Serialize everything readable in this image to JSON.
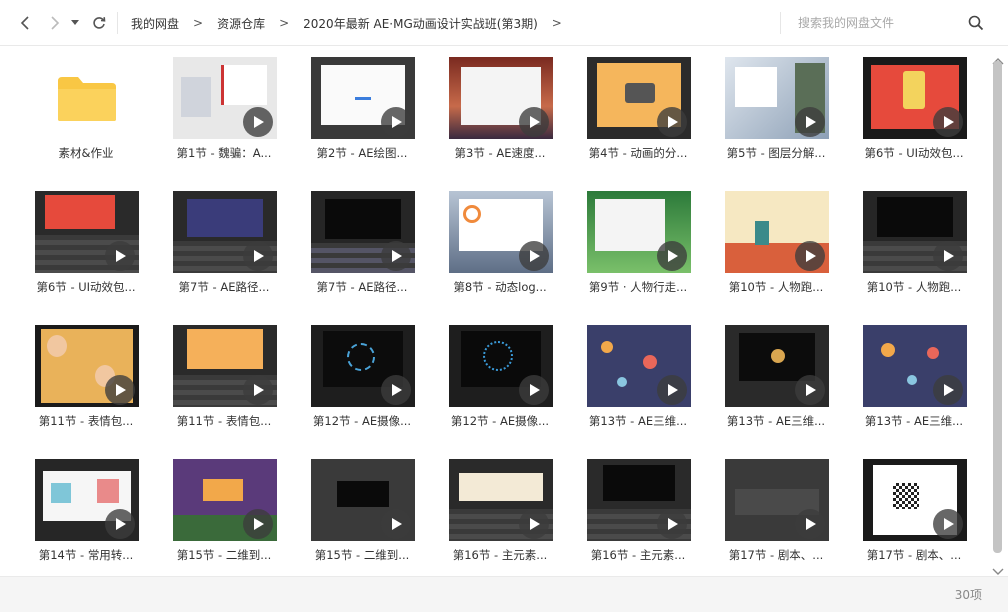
{
  "toolbar": {
    "breadcrumbs": [
      "我的网盘",
      "资源仓库",
      "2020年最新 AE·MG动画设计实战班(第3期)"
    ],
    "separator": ">",
    "icons": [
      "back-arrow-icon",
      "forward-arrow-icon",
      "dropdown-caret-icon",
      "refresh-icon"
    ]
  },
  "search": {
    "placeholder": "搜索我的网盘文件",
    "icon": "search-icon"
  },
  "items": [
    {
      "label": "素材&作业",
      "type": "folder"
    },
    {
      "label": "第1节 - 魏骗：A...",
      "type": "video"
    },
    {
      "label": "第2节 - AE绘图...",
      "type": "video"
    },
    {
      "label": "第3节 - AE速度...",
      "type": "video"
    },
    {
      "label": "第4节 - 动画的分...",
      "type": "video"
    },
    {
      "label": "第5节 - 图层分解...",
      "type": "video"
    },
    {
      "label": "第6节 - UI动效包...",
      "type": "video"
    },
    {
      "label": "第6节 - UI动效包...",
      "type": "video"
    },
    {
      "label": "第7节 - AE路径...",
      "type": "video"
    },
    {
      "label": "第7节 - AE路径...",
      "type": "video"
    },
    {
      "label": "第8节 - 动态log...",
      "type": "video"
    },
    {
      "label": "第9节 · 人物行走...",
      "type": "video"
    },
    {
      "label": "第10节 - 人物跑...",
      "type": "video"
    },
    {
      "label": "第10节 - 人物跑...",
      "type": "video"
    },
    {
      "label": "第11节 - 表情包...",
      "type": "video"
    },
    {
      "label": "第11节 - 表情包...",
      "type": "video"
    },
    {
      "label": "第12节 - AE摄像...",
      "type": "video"
    },
    {
      "label": "第12节 - AE摄像...",
      "type": "video"
    },
    {
      "label": "第13节 - AE三维...",
      "type": "video"
    },
    {
      "label": "第13节 - AE三维...",
      "type": "video"
    },
    {
      "label": "第13节 - AE三维...",
      "type": "video"
    },
    {
      "label": "第14节 - 常用转...",
      "type": "video"
    },
    {
      "label": "第15节 - 二维到...",
      "type": "video"
    },
    {
      "label": "第15节 - 二维到...",
      "type": "video"
    },
    {
      "label": "第16节 - 主元素...",
      "type": "video"
    },
    {
      "label": "第16节 - 主元素...",
      "type": "video"
    },
    {
      "label": "第17节 - 剧本、...",
      "type": "video"
    },
    {
      "label": "第17节 - 剧本、...",
      "type": "video"
    }
  ],
  "status": {
    "count": "30项"
  },
  "colors": {
    "folder": "#f9c744",
    "play_overlay": "#3c3c3c",
    "scrollbar": "#c4c4c4"
  }
}
